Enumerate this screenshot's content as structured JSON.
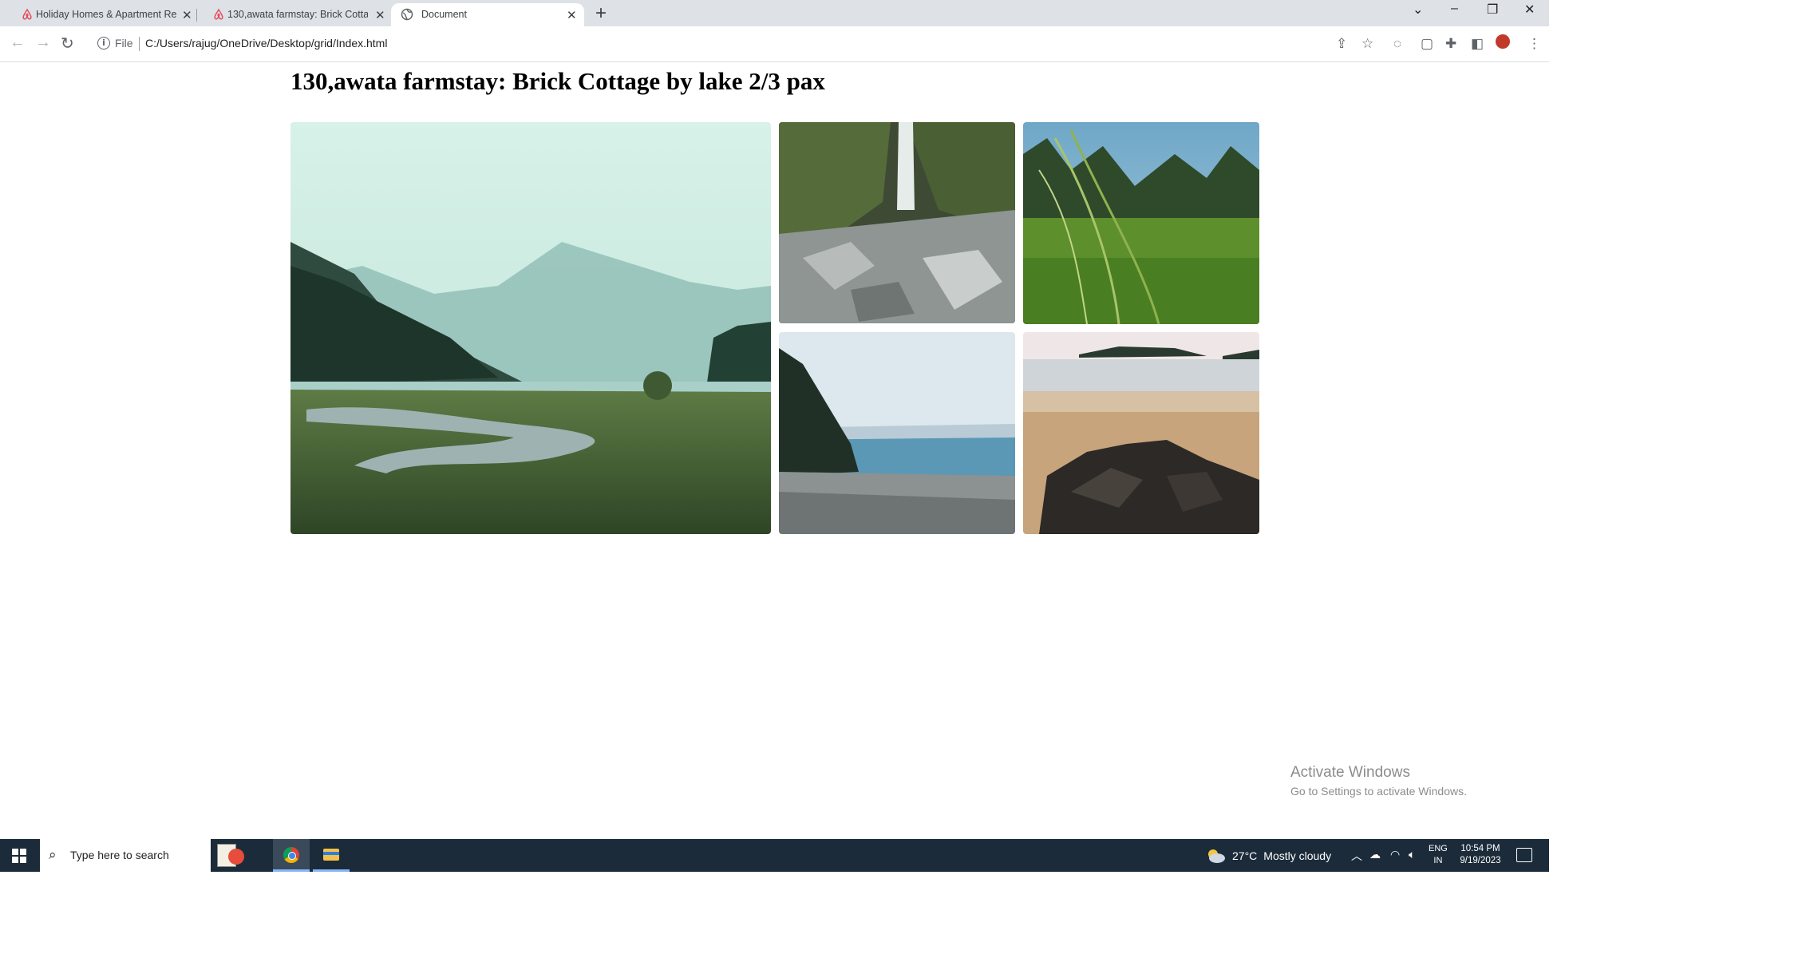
{
  "browser": {
    "tabs": [
      {
        "title": "Holiday Homes & Apartment Re",
        "active": false
      },
      {
        "title": "130,awata farmstay: Brick Cottag",
        "active": false
      },
      {
        "title": "Document",
        "active": true
      }
    ],
    "address_scheme": "File",
    "address_url": "C:/Users/rajug/OneDrive/Desktop/grid/Index.html"
  },
  "page": {
    "title": "130,awata farmstay: Brick Cottage by lake 2/3 pax"
  },
  "gallery": [
    {
      "subject": "misty lake valley with river and forest"
    },
    {
      "subject": "waterfall over rocky creek"
    },
    {
      "subject": "close-up of tall grass"
    },
    {
      "subject": "pebble beach with forested shore"
    },
    {
      "subject": "sandy beach with dark rocks and island"
    }
  ],
  "watermark": {
    "line1": "Activate Windows",
    "line2": "Go to Settings to activate Windows."
  },
  "taskbar": {
    "search_placeholder": "Type here to search",
    "weather_temp": "27°C",
    "weather_desc": "Mostly cloudy",
    "lang_line1": "ENG",
    "lang_line2": "IN",
    "time": "10:54 PM",
    "date": "9/19/2023"
  },
  "colors": {
    "tabstrip": "#dee1e6",
    "taskbar": "#1c2b3a"
  }
}
